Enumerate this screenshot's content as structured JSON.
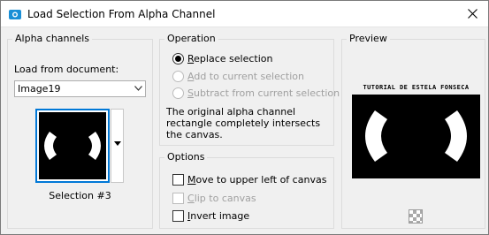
{
  "window": {
    "title": "Load Selection From Alpha Channel",
    "close_glyph": "✕"
  },
  "alpha_channels": {
    "group_title": "Alpha channels",
    "load_label": "Load from document:",
    "document_value": "Image19",
    "selection_name": "Selection #3"
  },
  "operation": {
    "group_title": "Operation",
    "options": [
      {
        "label_prefix": "",
        "underline": "R",
        "label_suffix": "eplace selection",
        "selected": true,
        "enabled": true
      },
      {
        "label_prefix": "",
        "underline": "A",
        "label_suffix": "dd to current selection",
        "selected": false,
        "enabled": false
      },
      {
        "label_prefix": "",
        "underline": "S",
        "label_suffix": "ubtract from current selection",
        "selected": false,
        "enabled": false
      }
    ],
    "description": "The original alpha channel rectangle completely intersects the canvas."
  },
  "options": {
    "group_title": "Options",
    "items": [
      {
        "label_prefix": "",
        "underline": "M",
        "label_suffix": "ove to upper left of canvas",
        "checked": false,
        "enabled": true
      },
      {
        "label_prefix": "",
        "underline": "C",
        "label_suffix": "lip to canvas",
        "checked": false,
        "enabled": false
      },
      {
        "label_prefix": "",
        "underline": "I",
        "label_suffix": "nvert image",
        "checked": false,
        "enabled": true
      }
    ]
  },
  "preview": {
    "group_title": "Preview",
    "caption": "TUTORIAL DE ESTELA FONSECA"
  },
  "icons": {
    "app": "camera-icon",
    "close": "close-icon",
    "dropdown": "chevron-down-icon",
    "transparency": "checkerboard-icon"
  },
  "colors": {
    "focus": "#0078d7",
    "window_bg": "#f0f0f0",
    "disabled_text": "#a0a0a0"
  }
}
